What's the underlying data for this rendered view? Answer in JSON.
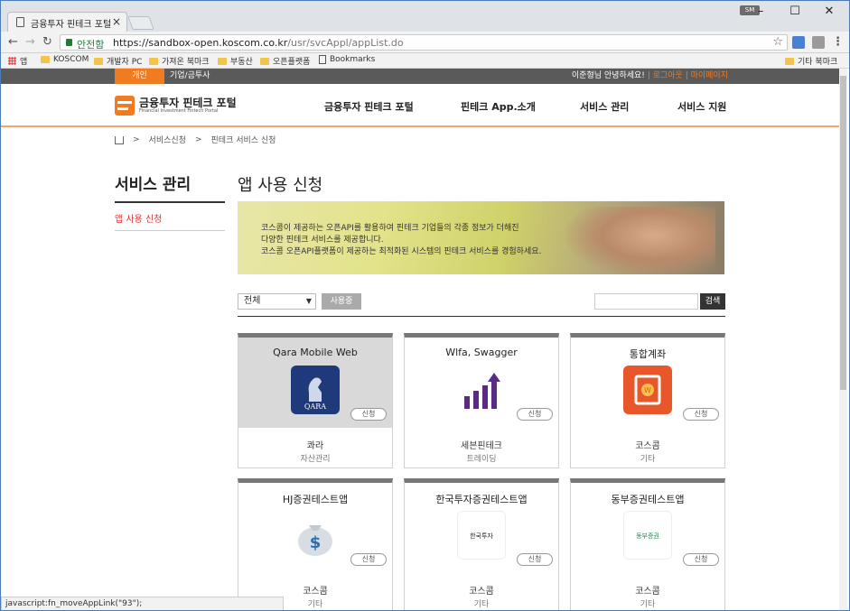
{
  "browser": {
    "tab_title": "금융투자 핀테크 포털",
    "secure_label": "안전함",
    "url_host": "https://sandbox-open.koscom.co.kr",
    "url_path": "/usr/svcAppl/appList.do",
    "user_badge": "SM"
  },
  "bookmarks": {
    "items": [
      "앱",
      "KOSCOM",
      "개발자 PC",
      "가져온 북마크",
      "부동산",
      "오픈플랫폼",
      "Bookmarks"
    ],
    "other": "기타 북마크"
  },
  "top": {
    "tab_personal": "개인",
    "tab_corp": "기업/금투사",
    "greeting": "이준형님 안녕하세요!",
    "logout": "로그아웃",
    "mypage": "마이페이지"
  },
  "header": {
    "logo_name": "금융투자 핀테크 포털",
    "logo_sub": "Financial Investment Fintech Portal",
    "nav": [
      "금융투자 핀테크 포털",
      "핀테크 App.소개",
      "서비스 관리",
      "서비스 지원"
    ]
  },
  "breadcrumb": {
    "items": [
      "서비스신청",
      "핀테크 서비스 신청"
    ]
  },
  "sidebar": {
    "title": "서비스 관리",
    "item": "앱 사용 신청"
  },
  "main": {
    "title": "앱 사용 신청",
    "banner_lines": [
      "코스콤이 제공하는 오픈API를 활용하여 핀테크 기업들의 각종 정보가 더해진",
      "다양한 핀테크 서비스를 제공합니다.",
      "코스콤 오픈API플랫폼이 제공하는 최적화된 시스템의 핀테크 서비스를 경험하세요."
    ],
    "filter_value": "전체",
    "filter_button": "사용중",
    "search_button": "검색",
    "apply_label": "신청"
  },
  "cards": [
    {
      "name": "Qara Mobile Web",
      "company": "콰라",
      "category": "자산관리",
      "icon": "qara-logo"
    },
    {
      "name": "Wlfa, Swagger",
      "company": "세븐핀테크",
      "category": "트레이딩",
      "icon": "bar-arrow-logo"
    },
    {
      "name": "통합계좌",
      "company": "코스콤",
      "category": "기타",
      "icon": "w-document-logo"
    },
    {
      "name": "HJ증권테스트앱",
      "company": "코스콤",
      "category": "기타",
      "icon": "money-bag-logo"
    },
    {
      "name": "한국투자증권테스트앱",
      "company": "코스콤",
      "category": "기타",
      "icon": "hankook-logo",
      "icon_text": "한국투자"
    },
    {
      "name": "동부증권테스트앱",
      "company": "코스콤",
      "category": "기타",
      "icon": "dongbu-logo",
      "icon_text": "동부증권"
    }
  ],
  "statusbar": "javascript:fn_moveAppLink(\"93\");"
}
